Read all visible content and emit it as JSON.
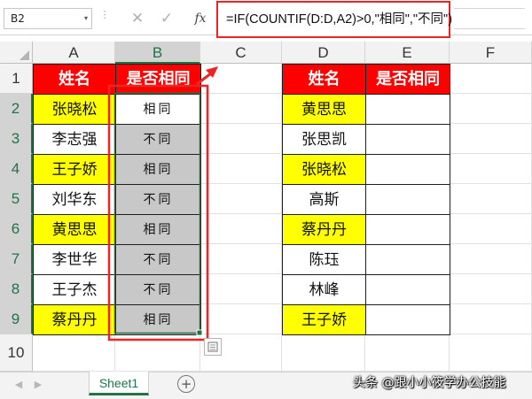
{
  "formula_bar": {
    "name_box": "B2",
    "name_box_arrow": "▾",
    "dots": "⋮",
    "cancel": "✕",
    "enter": "✓",
    "fx": "fx",
    "formula": "=IF(COUNTIF(D:D,A2)>0,\"相同\",\"不同\")"
  },
  "columns": [
    "A",
    "B",
    "C",
    "D",
    "E",
    "F"
  ],
  "rows": [
    "1",
    "2",
    "3",
    "4",
    "5",
    "6",
    "7",
    "8",
    "9",
    "10"
  ],
  "table_left": {
    "headers": [
      "姓名",
      "是否相同"
    ],
    "rows": [
      {
        "name": "张晓松",
        "result": "相同"
      },
      {
        "name": "李志强",
        "result": "不同"
      },
      {
        "name": "王子娇",
        "result": "相同"
      },
      {
        "name": "刘华东",
        "result": "不同"
      },
      {
        "name": "黄思思",
        "result": "相同"
      },
      {
        "name": "李世华",
        "result": "不同"
      },
      {
        "name": "王子杰",
        "result": "不同"
      },
      {
        "name": "蔡丹丹",
        "result": "相同"
      }
    ]
  },
  "table_right": {
    "headers": [
      "姓名",
      "是否相同"
    ],
    "rows": [
      {
        "name": "黄思思",
        "result": ""
      },
      {
        "name": "张思凯",
        "result": ""
      },
      {
        "name": "张晓松",
        "result": ""
      },
      {
        "name": "高斯",
        "result": ""
      },
      {
        "name": "蔡丹丹",
        "result": ""
      },
      {
        "name": "陈珏",
        "result": ""
      },
      {
        "name": "林峰",
        "result": ""
      },
      {
        "name": "王子娇",
        "result": ""
      }
    ]
  },
  "tabs": {
    "nav_prev": "◀",
    "nav_next": "▶",
    "sheet_name": "Sheet1",
    "add": "+"
  },
  "watermark": "头条 @跟小小筱学办公技能",
  "colors": {
    "header_fill": "#ff0000",
    "highlight_fill": "#ffff00",
    "selection_fill": "#c8c8c8",
    "annotation_red": "#ee2424",
    "excel_green": "#217346"
  }
}
